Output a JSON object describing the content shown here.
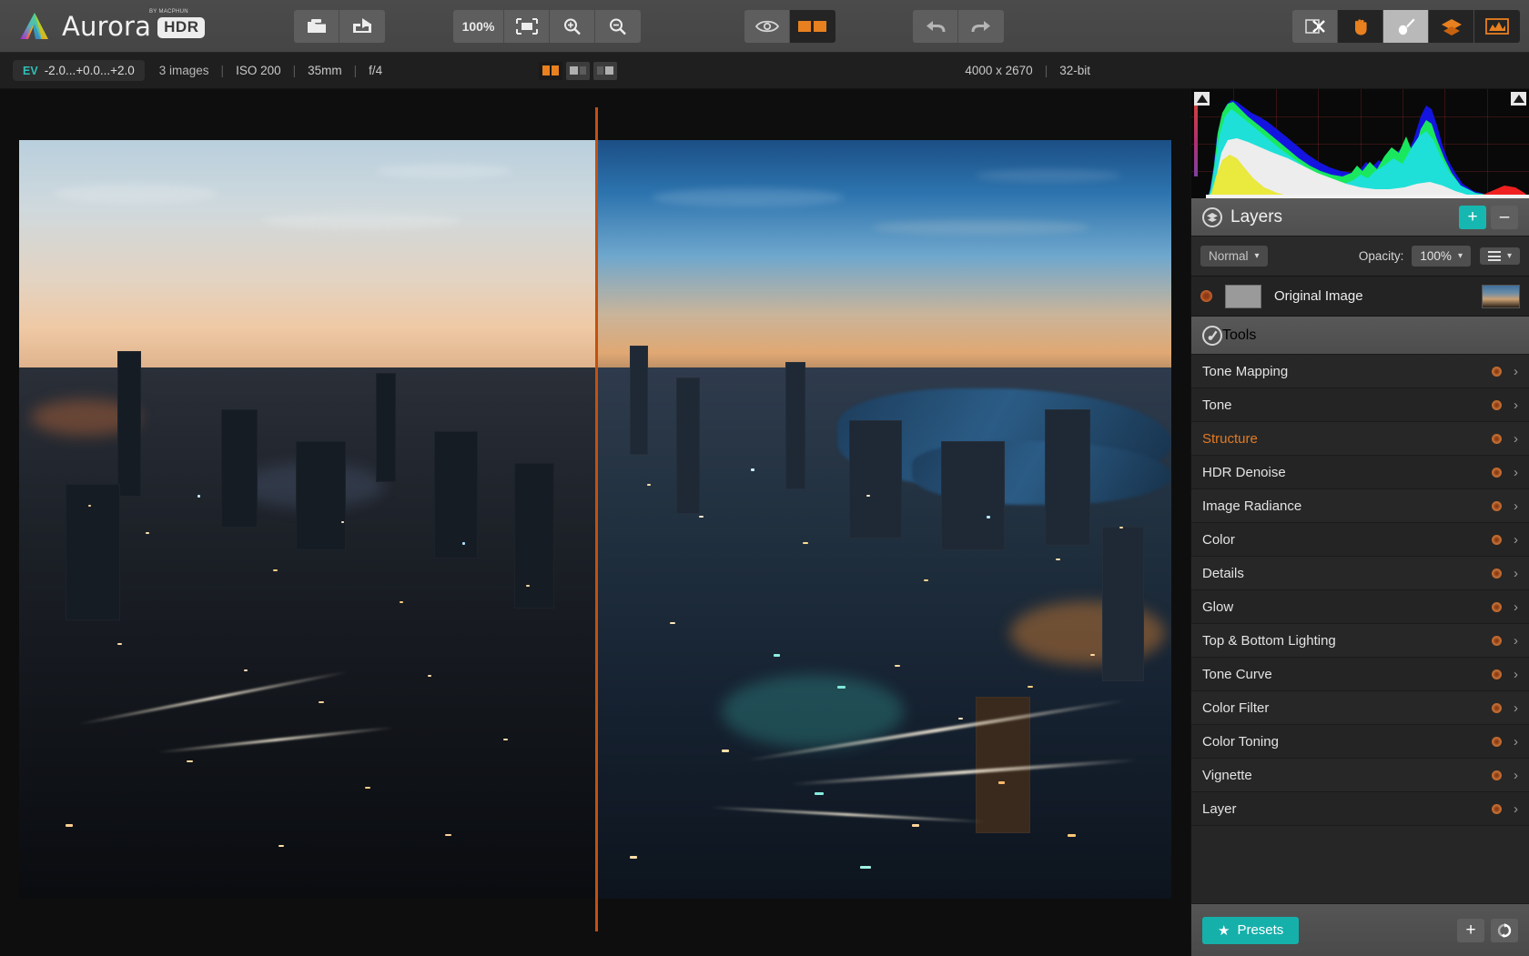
{
  "app": {
    "name": "Aurora",
    "badge": "HDR",
    "trademark": "BY MACPHUN"
  },
  "toolbar": {
    "open_label": "open-icon",
    "share_label": "share-icon",
    "zoom_level": "100%",
    "fit_label": "fit-to-screen-icon",
    "zoom_in_label": "zoom-in-icon",
    "zoom_out_label": "zoom-out-icon",
    "preview_label": "eye-icon",
    "compare_label": "compare-split-icon",
    "undo_label": "undo-icon",
    "redo_label": "redo-icon",
    "crop_label": "crop-icon",
    "hand_label": "hand-icon",
    "brush_label": "brush-icon",
    "layers_label": "layers-icon",
    "histogram_label": "histogram-icon"
  },
  "infobar": {
    "ev_label": "EV",
    "ev_value": "-2.0...+0.0...+2.0",
    "images": "3 images",
    "iso": "ISO 200",
    "focal": "35mm",
    "aperture": "f/4",
    "dimensions": "4000 x 2670",
    "bitdepth": "32-bit",
    "view_modes": [
      "split-view-icon",
      "side-by-side-icon",
      "single-view-icon"
    ],
    "active_view_mode": 0
  },
  "histogram": {
    "label": "histogram",
    "clip_left": "shadow-clipping-warning",
    "clip_right": "highlight-clipping-warning"
  },
  "layers_panel": {
    "title": "Layers",
    "icon": "layers-stack-icon",
    "add_label": "+",
    "remove_label": "–",
    "blend_mode": "Normal",
    "opacity_label": "Opacity:",
    "opacity_value": "100%",
    "menu_label": "layer-options-menu",
    "layers": [
      {
        "name": "Original Image",
        "visible": true
      }
    ]
  },
  "tools_panel": {
    "title": "Tools",
    "icon": "tools-icon",
    "items": [
      {
        "label": "Tone Mapping",
        "active": false
      },
      {
        "label": "Tone",
        "active": false
      },
      {
        "label": "Structure",
        "active": true
      },
      {
        "label": "HDR Denoise",
        "active": false
      },
      {
        "label": "Image Radiance",
        "active": false
      },
      {
        "label": "Color",
        "active": false
      },
      {
        "label": "Details",
        "active": false
      },
      {
        "label": "Glow",
        "active": false
      },
      {
        "label": "Top & Bottom Lighting",
        "active": false
      },
      {
        "label": "Tone Curve",
        "active": false
      },
      {
        "label": "Color Filter",
        "active": false
      },
      {
        "label": "Color Toning",
        "active": false
      },
      {
        "label": "Vignette",
        "active": false
      },
      {
        "label": "Layer",
        "active": false
      }
    ]
  },
  "presets_bar": {
    "label": "Presets",
    "star_icon": "star-icon",
    "add_label": "+",
    "sync_label": "sync-icon"
  },
  "canvas": {
    "left_caption": "original-unprocessed-preview",
    "right_caption": "hdr-processed-preview",
    "split_handle": "split-divider"
  },
  "colors": {
    "accent_orange": "#e07b26",
    "accent_teal": "#16b0ab",
    "split_line": "#c4500f",
    "panel_bg": "#1e1e1e",
    "toolbar_bg": "#4b4b4b"
  }
}
